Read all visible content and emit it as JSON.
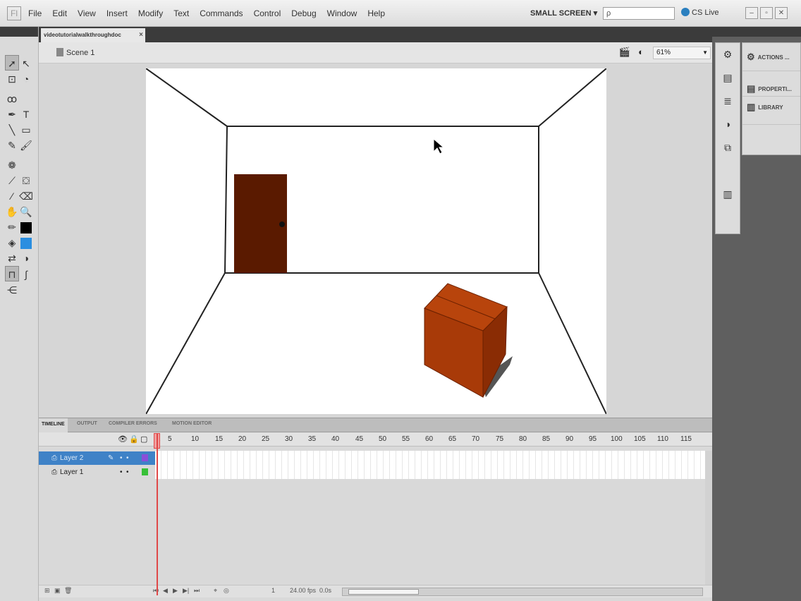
{
  "app": {
    "logo": "Fl"
  },
  "menu": [
    "File",
    "Edit",
    "View",
    "Insert",
    "Modify",
    "Text",
    "Commands",
    "Control",
    "Debug",
    "Window",
    "Help"
  ],
  "workspace": "SMALL SCREEN ▾",
  "search": {
    "placeholder": "ρ"
  },
  "cs_live": "CS Live",
  "document": {
    "tab_title": "videotutorialwalkthroughdoc",
    "close": "×"
  },
  "scene": {
    "label": "Scene 1",
    "zoom": "61%"
  },
  "right_panel": {
    "actions": "ACTIONS ...",
    "properties": "PROPERTI...",
    "library": "LIBRARY"
  },
  "timeline": {
    "tabs": [
      "TIMELINE",
      "OUTPUT",
      "COMPILER ERRORS",
      "MOTION EDITOR"
    ],
    "ruler": [
      "1",
      "5",
      "10",
      "15",
      "20",
      "25",
      "30",
      "35",
      "40",
      "45",
      "50",
      "55",
      "60",
      "65",
      "70",
      "75",
      "80",
      "85",
      "90",
      "95",
      "100",
      "105",
      "110",
      "115"
    ],
    "layers": [
      {
        "name": "Layer 2",
        "color": "#8a4fd8"
      },
      {
        "name": "Layer 1",
        "color": "#38c038"
      }
    ],
    "footer": {
      "frame": "1",
      "fps": "24.00 fps",
      "time": "0.0s"
    }
  },
  "colors": {
    "door": "#5a1a00",
    "box": "#a83a08",
    "fill_swatch": "#2a8ee0",
    "stroke_swatch": "#000000"
  }
}
